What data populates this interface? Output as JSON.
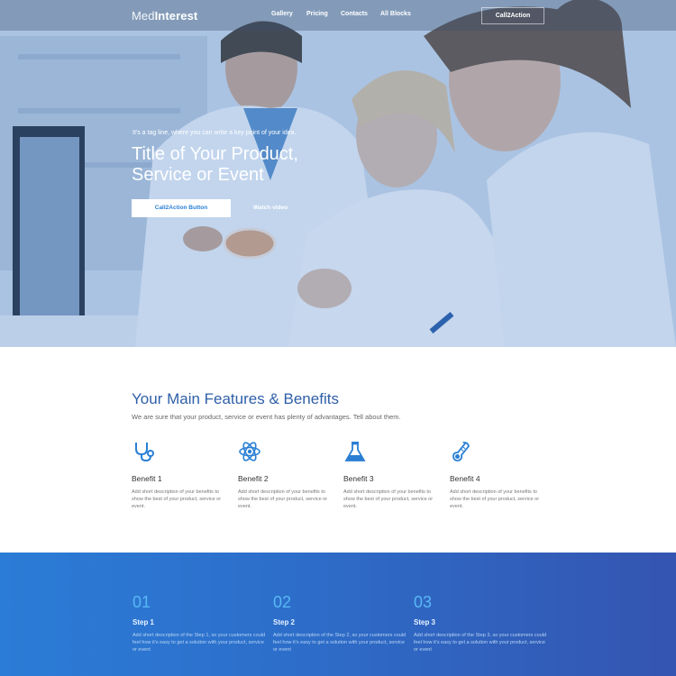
{
  "brand": {
    "part1": "Med",
    "part2": "Interest"
  },
  "nav": {
    "links": [
      "Gallery",
      "Pricing",
      "Contacts",
      "All Blocks"
    ],
    "cta": "Call2Action"
  },
  "hero": {
    "tagline": "It's a tag line, where you can write a key point of your idea.",
    "title": "Title of Your Product, Service or Event",
    "cta_button": "Call2Action Button",
    "watch_video": "Watch video"
  },
  "features": {
    "title": "Your Main Features & Benefits",
    "subtitle": "We are sure that your product, service or event has plenty of advantages. Tell about them.",
    "benefits": [
      {
        "icon": "stethoscope-icon",
        "title": "Benefit 1",
        "description": "Add short description of your benefits to show the best of your product, service or event."
      },
      {
        "icon": "atom-icon",
        "title": "Benefit 2",
        "description": "Add short description of your benefits to show the best of your product, service or event."
      },
      {
        "icon": "flask-icon",
        "title": "Benefit 3",
        "description": "Add short description of your benefits to show the best of your product, service or event."
      },
      {
        "icon": "thermometer-icon",
        "title": "Benefit 4",
        "description": "Add short description of your benefits to show the best of your product, service or event."
      }
    ]
  },
  "steps": [
    {
      "number": "01",
      "title": "Step 1",
      "description": "Add short description of the Step 1, so your customers could feel how it's easy to get a solution with your product, service or event"
    },
    {
      "number": "02",
      "title": "Step 2",
      "description": "Add short description of the Step 2, so your customers could feel how it's easy to get a solution with your product, service or event"
    },
    {
      "number": "03",
      "title": "Step 3",
      "description": "Add short description of the Step 3, so your customers could feel how it's easy to get a solution with your product, service or event"
    }
  ],
  "colors": {
    "accent": "#2f5fa8",
    "icon_blue": "#2a7fd4",
    "steps_gradient_start": "#2b7cd6",
    "steps_gradient_end": "#3455b1",
    "step_number": "#58b8f5"
  }
}
